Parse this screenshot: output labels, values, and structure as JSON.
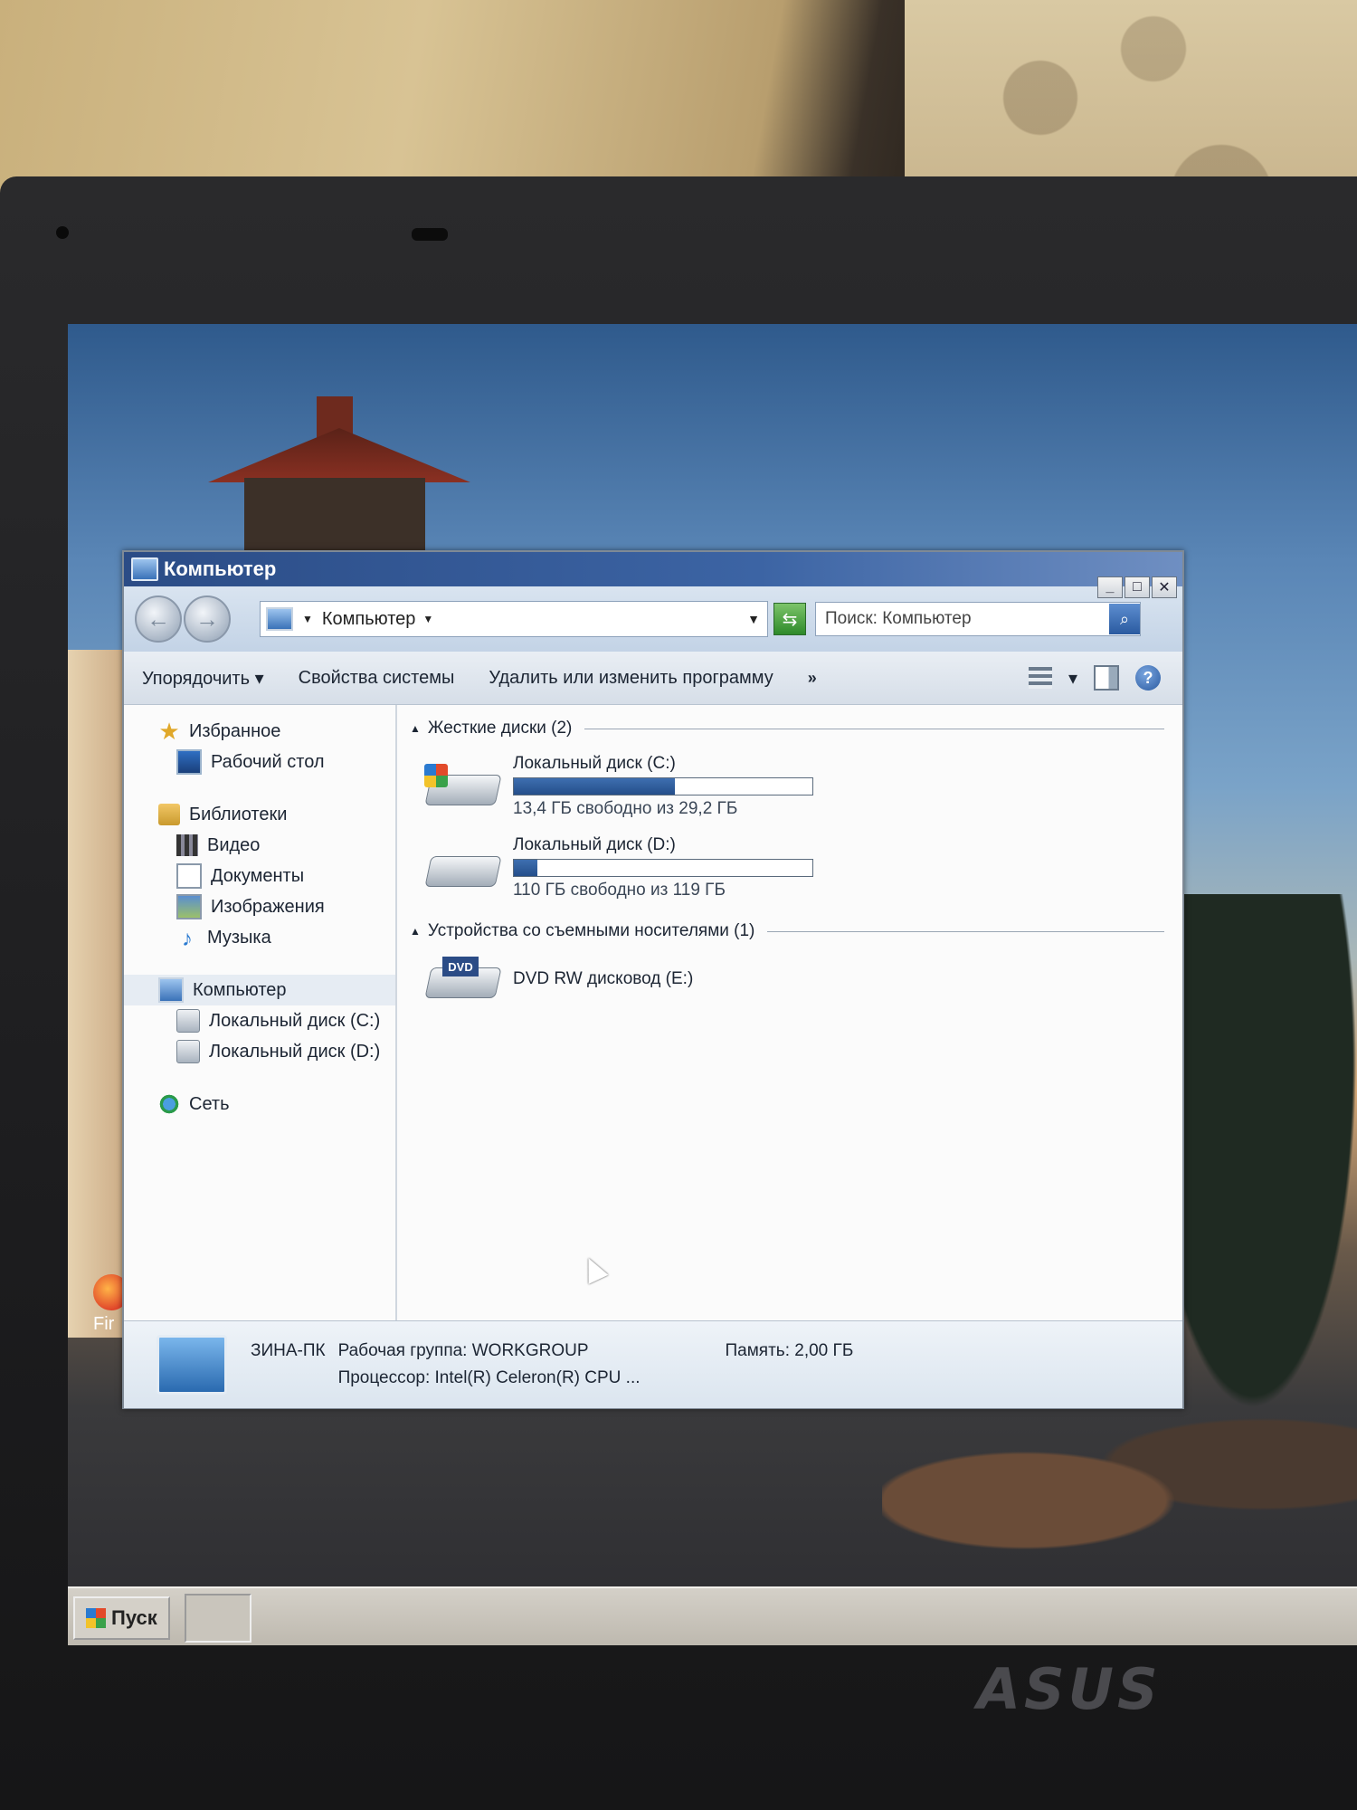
{
  "window": {
    "title": "Компьютер",
    "controls": {
      "minimize": "_",
      "maximize": "□",
      "close": "✕"
    }
  },
  "navbar": {
    "back_icon": "back-arrow-icon",
    "forward_icon": "forward-arrow-icon",
    "address": "Компьютер",
    "search_placeholder": "Поиск: Компьютер"
  },
  "toolbar": {
    "organize": "Упорядочить",
    "system_properties": "Свойства системы",
    "uninstall": "Удалить или изменить программу",
    "more": "»"
  },
  "sidebar": {
    "favorites": "Избранное",
    "desktop": "Рабочий стол",
    "libraries": "Библиотеки",
    "video": "Видео",
    "documents": "Документы",
    "images": "Изображения",
    "music": "Музыка",
    "computer": "Компьютер",
    "disk_c": "Локальный диск (C:)",
    "disk_d": "Локальный диск (D:)",
    "network": "Сеть"
  },
  "content": {
    "hard_disks_header": "Жесткие диски (2)",
    "removable_header": "Устройства со съемными носителями (1)",
    "drives": [
      {
        "name": "Локальный диск (C:)",
        "free": "13,4 ГБ свободно из 29,2 ГБ",
        "used_fraction": 0.54
      },
      {
        "name": "Локальный диск (D:)",
        "free": "110 ГБ свободно из 119 ГБ",
        "used_fraction": 0.08
      }
    ],
    "dvd": {
      "name": "DVD RW дисковод (E:)",
      "badge": "DVD"
    }
  },
  "details": {
    "pc_name": "ЗИНА-ПК",
    "workgroup_label": "Рабочая группа:",
    "workgroup_value": "WORKGROUP",
    "memory_label": "Память:",
    "memory_value": "2,00 ГБ",
    "cpu_label": "Процессор:",
    "cpu_value": "Intel(R) Celeron(R) CPU ..."
  },
  "desktop": {
    "icon_label": "Fir"
  },
  "taskbar": {
    "start": "Пуск"
  },
  "laptop": {
    "brand": "ASUS"
  }
}
